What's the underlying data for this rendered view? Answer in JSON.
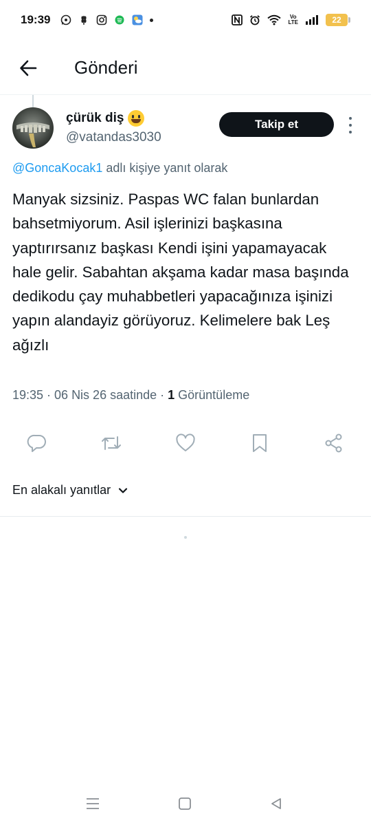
{
  "status_bar": {
    "time": "19:39",
    "battery": "22",
    "left_icons": [
      "whatsapp-icon",
      "wheat-icon",
      "instagram-icon",
      "spotify-icon",
      "weather-icon"
    ],
    "right_icons": [
      "nfc-icon",
      "alarm-icon",
      "wifi-icon",
      "volte-icon",
      "signal-icon",
      "battery-icon"
    ],
    "volte_top": "Vo",
    "volte_bottom": "LTE"
  },
  "header": {
    "title": "Gönderi",
    "back_icon": "arrow-left-icon"
  },
  "post": {
    "display_name": "çürük diş",
    "handle": "@vatandas3030",
    "follow_label": "Takip et",
    "reply_to_mention": "@GoncaKocak1",
    "reply_to_suffix": " adlı kişiye yanıt olarak",
    "text": "Manyak sizsiniz. Paspas WC falan bunlardan bahsetmiyorum. Asil işlerinizi başkasına yaptırırsanız başkası Kendi işini yapamayacak hale gelir. Sabahtan akşama kadar masa başında dedikodu çay muhabbetleri yapacağınıza işinizi yapın alandayiz görüyoruz. Kelimelere bak Leş ağızlı",
    "meta_time": "19:35 · 06 Nis 26 saatinde · ",
    "meta_views_count": "1",
    "meta_views_label": " Görüntüleme"
  },
  "actions": [
    "reply-icon",
    "repost-icon",
    "like-icon",
    "bookmark-icon",
    "share-icon"
  ],
  "sort": {
    "label": "En alakalı yanıtlar"
  },
  "colors": {
    "accent": "#1d9bf0",
    "text_primary": "#0f1419",
    "text_secondary": "#536471",
    "follow_button_bg": "#0f1419",
    "battery": "#f2c14e"
  }
}
